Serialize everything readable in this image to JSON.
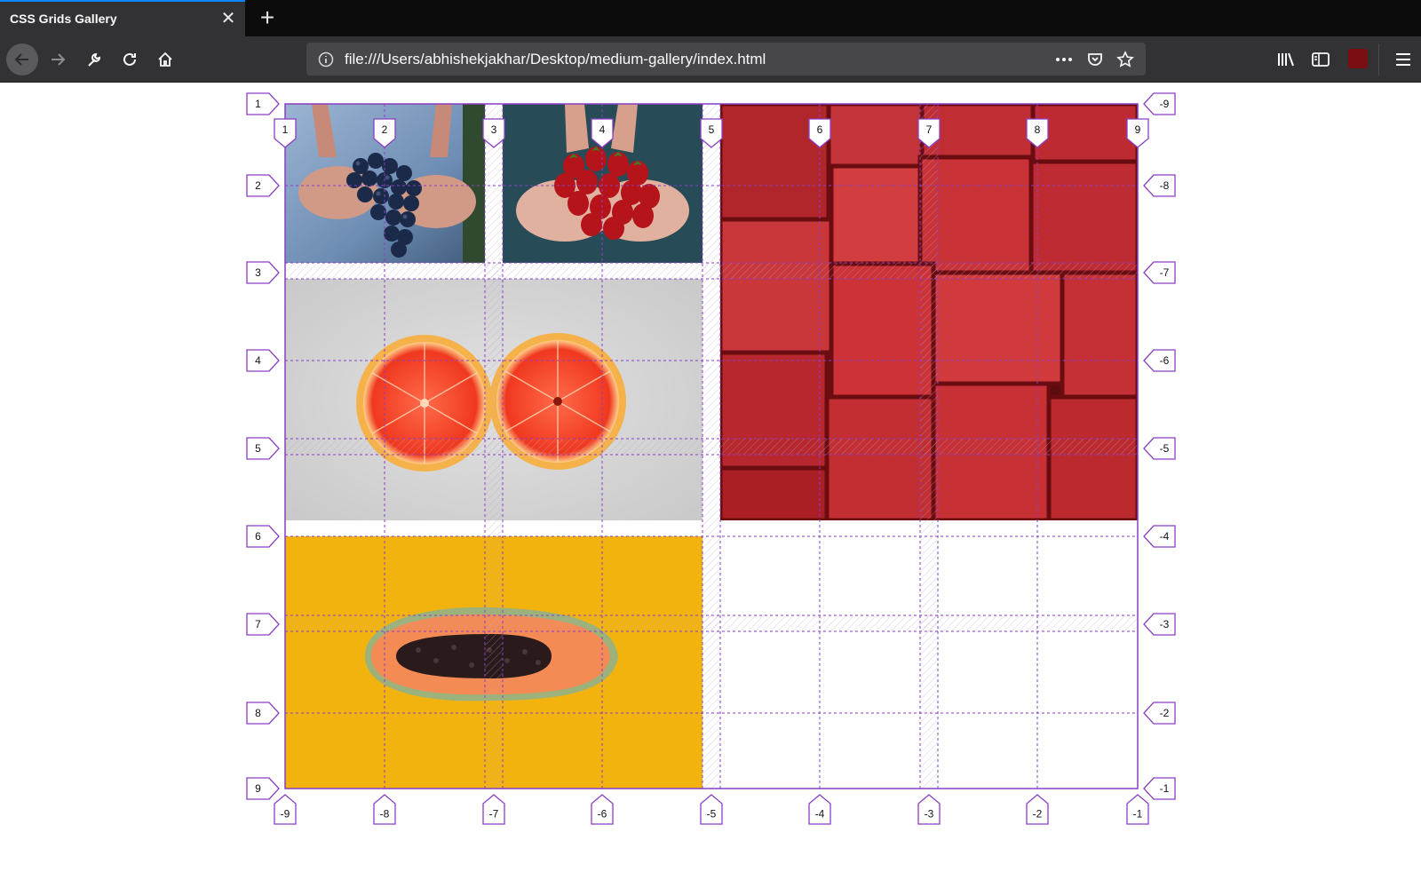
{
  "tab": {
    "title": "CSS Grids Gallery",
    "close_glyph": "✕"
  },
  "new_tab_glyph": "+",
  "nav": {
    "back": "back-arrow-icon",
    "forward": "forward-arrow-icon",
    "tools": "wrench-icon",
    "reload": "reload-icon",
    "home": "home-icon"
  },
  "urlbar": {
    "url": "file:///Users/abhishekjakhar/Desktop/medium-gallery/index.html"
  },
  "toolbar_icons": [
    "library-icon",
    "sidebar-icon",
    "extension-icon",
    "hamburger-menu-icon"
  ],
  "gallery": {
    "images": [
      {
        "name": "grapes",
        "description": "hands holding grapes"
      },
      {
        "name": "strawberries",
        "description": "hands holding strawberries"
      },
      {
        "name": "grapefruit",
        "description": "grapefruit halves"
      },
      {
        "name": "watermelon",
        "description": "watermelon cubes"
      },
      {
        "name": "papaya",
        "description": "papaya half"
      }
    ]
  },
  "grid_overlay": {
    "color": "#8a3ec4",
    "left_row_labels": [
      "1",
      "2",
      "3",
      "4",
      "5",
      "6",
      "7",
      "8",
      "9"
    ],
    "right_row_labels": [
      "-9",
      "-8",
      "-7",
      "-6",
      "-5",
      "-4",
      "-3",
      "-2",
      "-1"
    ],
    "top_col_labels": [
      "1",
      "2",
      "3",
      "4",
      "5",
      "6",
      "7",
      "8",
      "9"
    ],
    "bottom_col_labels": [
      "-9",
      "-8",
      "-7",
      "-6",
      "-5",
      "-4",
      "-3",
      "-2",
      "-1"
    ]
  }
}
